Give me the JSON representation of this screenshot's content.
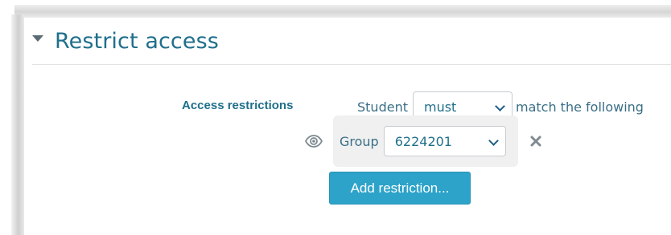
{
  "section": {
    "title": "Restrict access"
  },
  "restrictions": {
    "label": "Access restrictions",
    "prefix": "Student",
    "condition_select": {
      "value": "must",
      "options": [
        "must"
      ]
    },
    "suffix": "match the following",
    "group_rule": {
      "label": "Group",
      "group_select": {
        "value": "6224201",
        "options": [
          "6224201"
        ]
      }
    },
    "add_button_label": "Add restriction..."
  },
  "colors": {
    "accent": "#1f6f8b",
    "button": "#2da3c9",
    "group_box_bg": "#f0f0f0"
  },
  "icons": {
    "section_toggle": "caret-down-icon",
    "visibility": "eye-icon",
    "remove": "close-icon",
    "select_arrow": "chevron-down-icon"
  }
}
